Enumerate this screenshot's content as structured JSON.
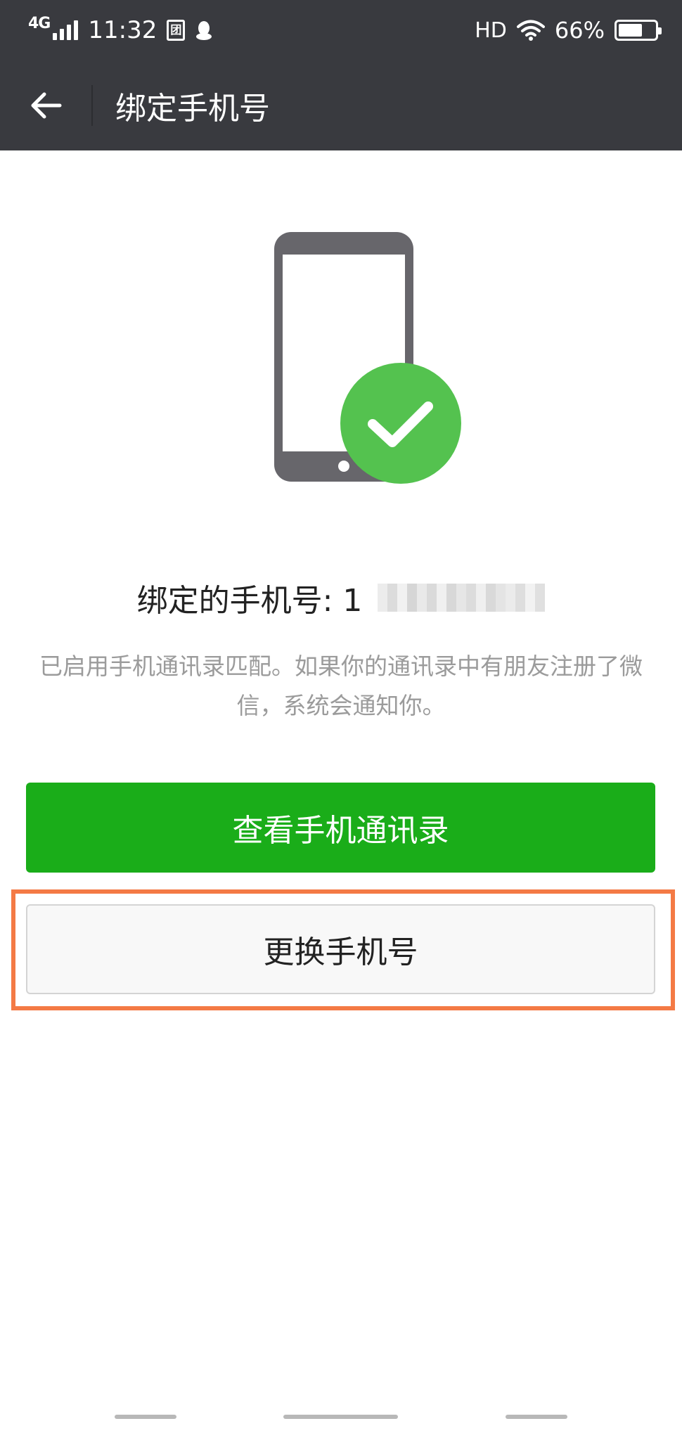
{
  "status_bar": {
    "network": "4G",
    "time": "11:32",
    "hd": "HD",
    "battery_percent": "66%",
    "battery_level": 0.66,
    "icons": [
      "signal-icon",
      "sim-card-icon",
      "qq-penguin-icon",
      "wifi-icon",
      "battery-icon"
    ]
  },
  "nav": {
    "title": "绑定手机号",
    "back_icon": "arrow-left-icon"
  },
  "illustration": {
    "icons": [
      "phone-icon",
      "check-circle-icon"
    ],
    "colors": {
      "phone": "#67666b",
      "check": "#54c24f"
    }
  },
  "phone": {
    "label": "绑定的手机号: 1"
  },
  "description": "已启用手机通讯录匹配。如果你的通讯录中有朋友注册了微信，系统会通知你。",
  "buttons": {
    "view_contacts": "查看手机通讯录",
    "change_phone": "更换手机号"
  },
  "colors": {
    "nav_background": "#393a3f",
    "primary_button": "#1aad19",
    "highlight_border": "#f47a45"
  }
}
